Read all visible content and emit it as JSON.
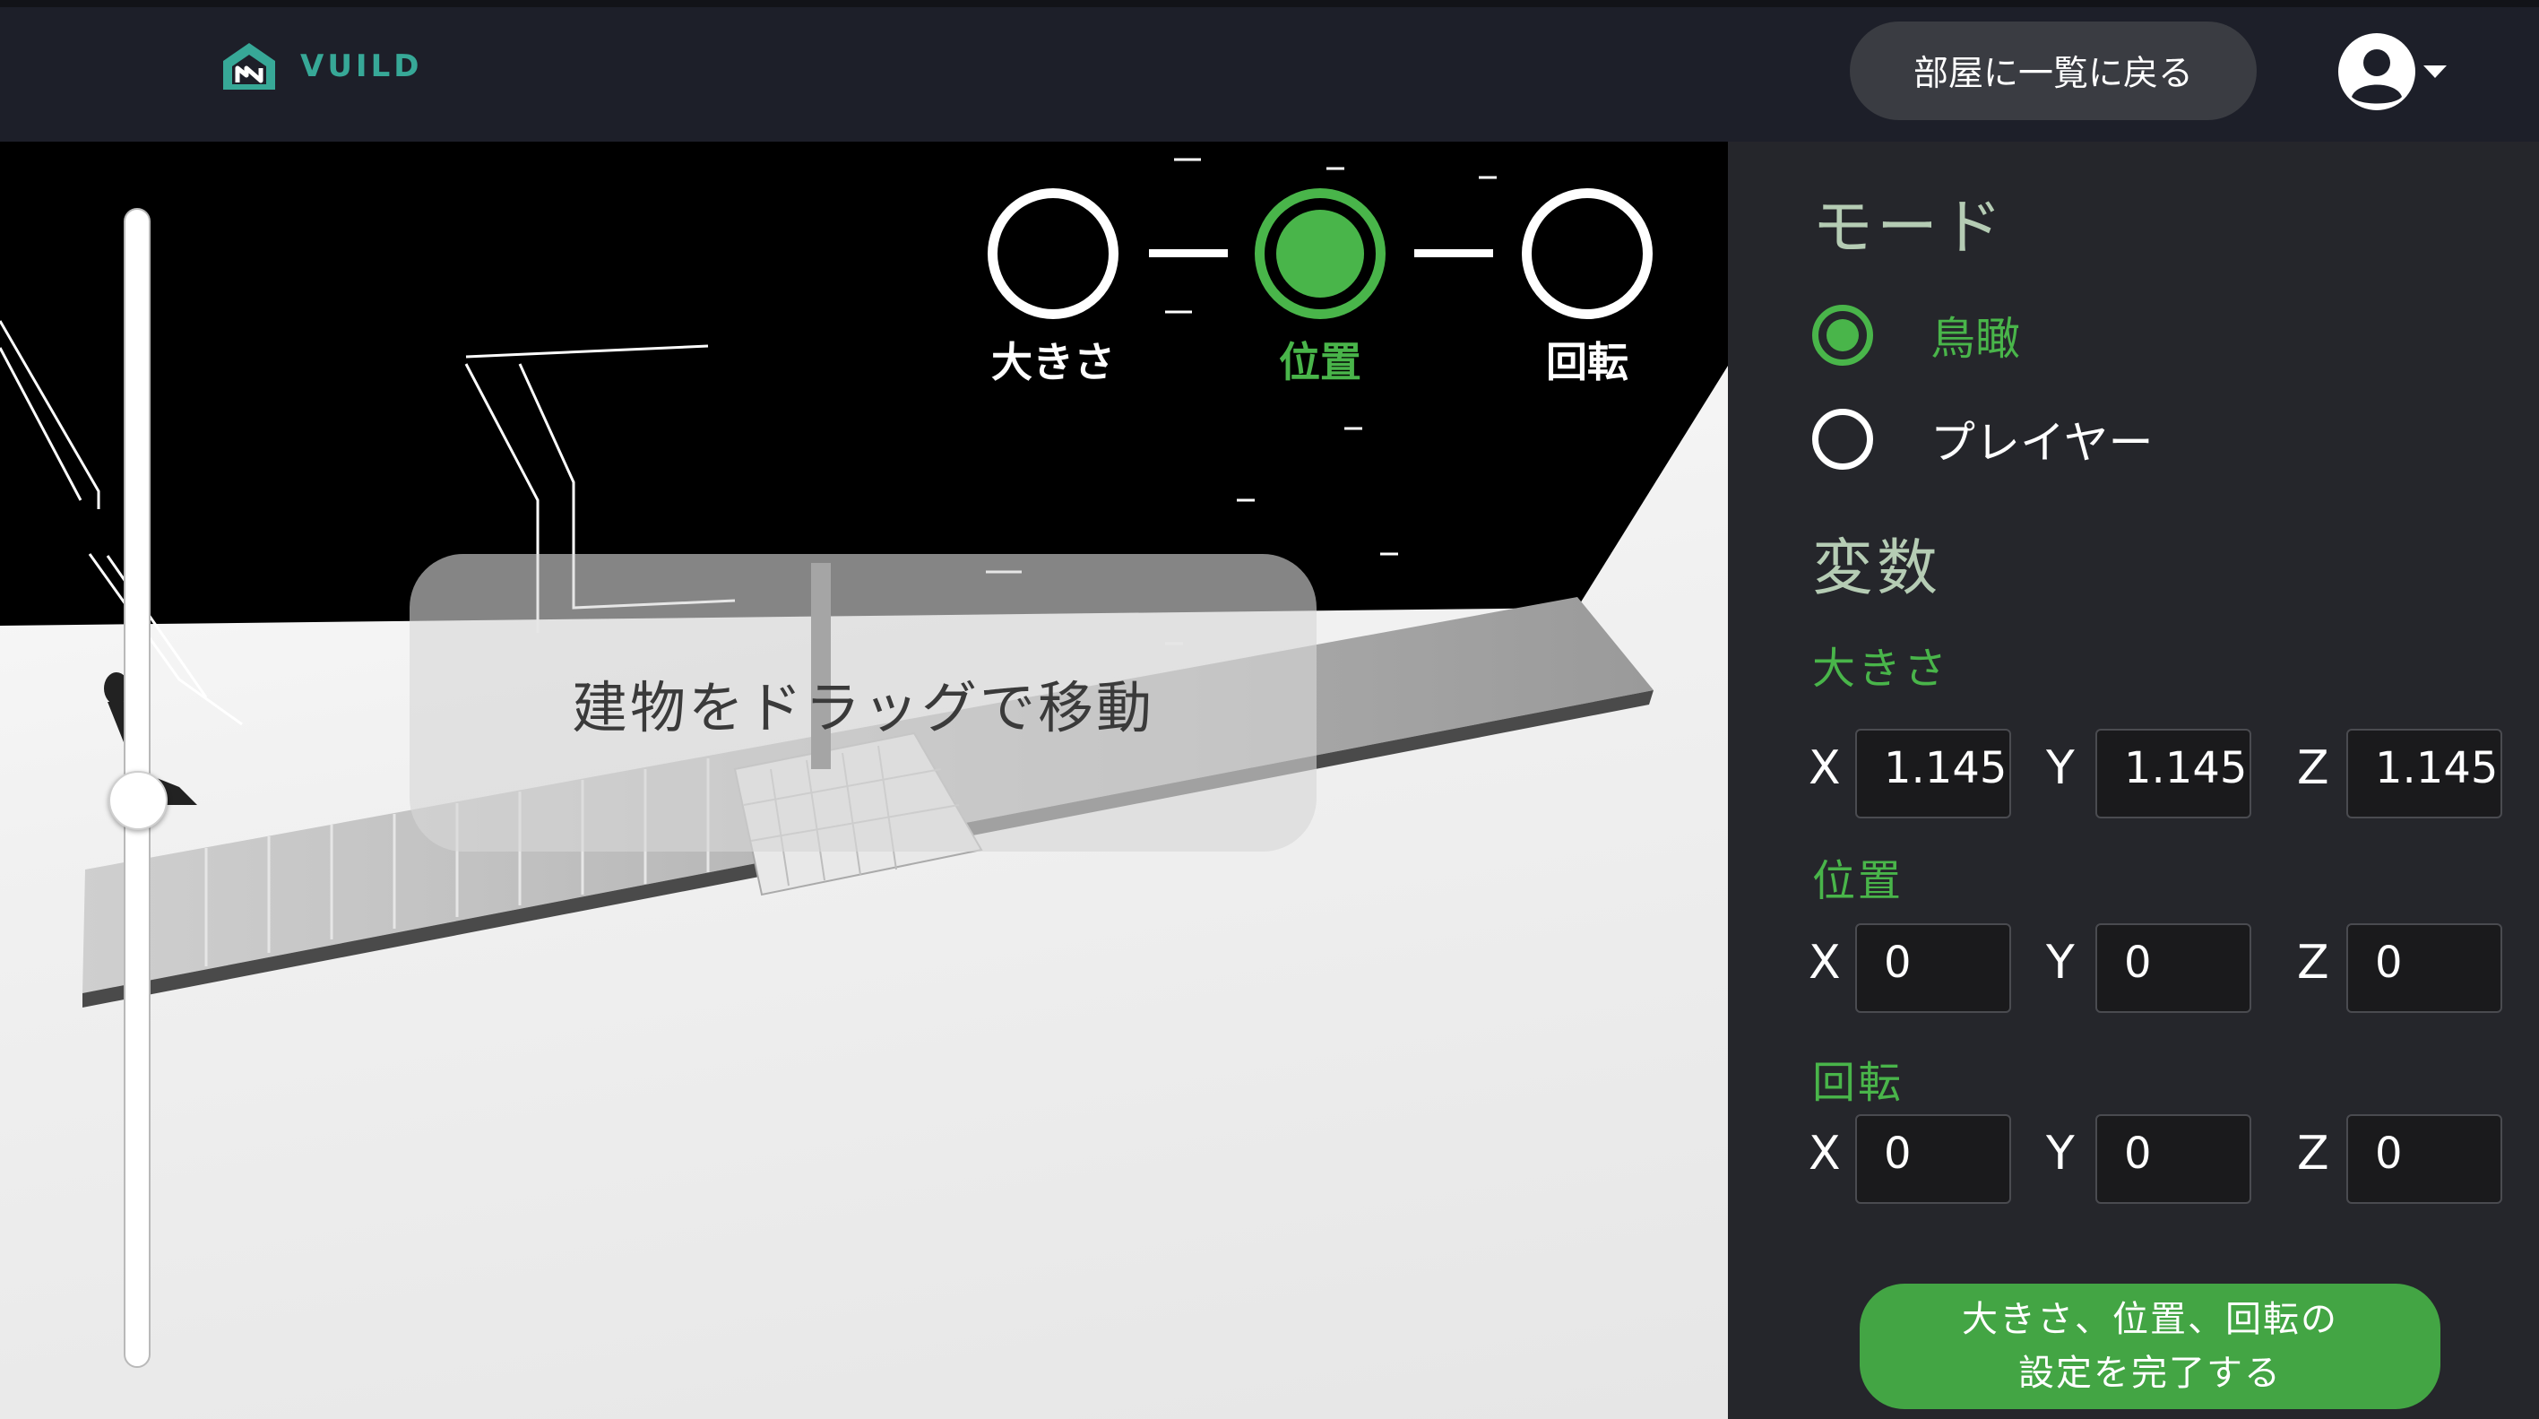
{
  "header": {
    "brand": "VUILD",
    "back_button": "部屋に一覧に戻る",
    "user_icon": "user-circle-icon",
    "menu_icon": "caret-down-icon"
  },
  "viewport": {
    "zoom_level": 0.51,
    "steps": [
      {
        "label": "大きさ",
        "state": "inactive"
      },
      {
        "label": "位置",
        "state": "active"
      },
      {
        "label": "回転",
        "state": "inactive"
      }
    ],
    "toast": "建物をドラッグで移動"
  },
  "panel": {
    "mode_title": "モード",
    "modes": [
      {
        "label": "鳥瞰",
        "checked": true
      },
      {
        "label": "プレイヤー",
        "checked": false
      }
    ],
    "variables_title": "変数",
    "size": {
      "label": "大きさ",
      "x_label": "X",
      "y_label": "Y",
      "z_label": "Z",
      "x": "1.1453",
      "y": "1.1453",
      "z": "1.1453"
    },
    "position": {
      "label": "位置",
      "x_label": "X",
      "y_label": "Y",
      "z_label": "Z",
      "x": "0",
      "y": "0",
      "z": "0"
    },
    "rotation": {
      "label": "回転",
      "x_label": "X",
      "y_label": "Y",
      "z_label": "Z",
      "x": "0",
      "y": "0",
      "z": "0"
    },
    "done_button_line1": "大きさ、位置、回転の",
    "done_button_line2": "設定を完了する"
  },
  "colors": {
    "accent_green": "#49b54a",
    "header_bg": "#1d1f29",
    "panel_bg": "#25262b",
    "brand_teal": "#37a897"
  }
}
